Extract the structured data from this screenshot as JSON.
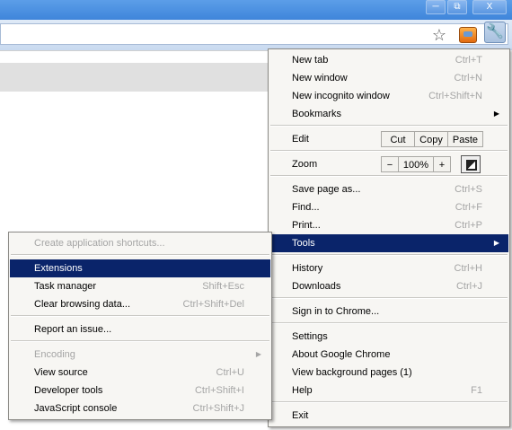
{
  "window": {
    "minimize_icon": "minimize-icon",
    "restore_icon": "restore-icon",
    "close_label": "X",
    "close_icon": "close-icon"
  },
  "toolbar": {
    "star_icon": "star-icon",
    "extension_icon": "extension-icon",
    "wrench_icon": "wrench-icon"
  },
  "main_menu": {
    "new_tab": {
      "label": "New tab",
      "shortcut": "Ctrl+T"
    },
    "new_window": {
      "label": "New window",
      "shortcut": "Ctrl+N"
    },
    "new_incognito": {
      "label": "New incognito window",
      "shortcut": "Ctrl+Shift+N"
    },
    "bookmarks": {
      "label": "Bookmarks"
    },
    "edit": {
      "label": "Edit",
      "cut": "Cut",
      "copy": "Copy",
      "paste": "Paste"
    },
    "zoom": {
      "label": "Zoom",
      "minus": "−",
      "value": "100%",
      "plus": "+"
    },
    "save_page": {
      "label": "Save page as...",
      "shortcut": "Ctrl+S"
    },
    "find": {
      "label": "Find...",
      "shortcut": "Ctrl+F"
    },
    "print": {
      "label": "Print...",
      "shortcut": "Ctrl+P"
    },
    "tools": {
      "label": "Tools"
    },
    "history": {
      "label": "History",
      "shortcut": "Ctrl+H"
    },
    "downloads": {
      "label": "Downloads",
      "shortcut": "Ctrl+J"
    },
    "sign_in": {
      "label": "Sign in to Chrome..."
    },
    "settings": {
      "label": "Settings"
    },
    "about": {
      "label": "About Google Chrome"
    },
    "background_pages": {
      "label": "View background pages (1)"
    },
    "help": {
      "label": "Help",
      "shortcut": "F1"
    },
    "exit": {
      "label": "Exit"
    }
  },
  "tools_menu": {
    "create_shortcuts": {
      "label": "Create application shortcuts..."
    },
    "extensions": {
      "label": "Extensions"
    },
    "task_manager": {
      "label": "Task manager",
      "shortcut": "Shift+Esc"
    },
    "clear_data": {
      "label": "Clear browsing data...",
      "shortcut": "Ctrl+Shift+Del"
    },
    "report_issue": {
      "label": "Report an issue..."
    },
    "encoding": {
      "label": "Encoding"
    },
    "view_source": {
      "label": "View source",
      "shortcut": "Ctrl+U"
    },
    "dev_tools": {
      "label": "Developer tools",
      "shortcut": "Ctrl+Shift+I"
    },
    "js_console": {
      "label": "JavaScript console",
      "shortcut": "Ctrl+Shift+J"
    }
  }
}
